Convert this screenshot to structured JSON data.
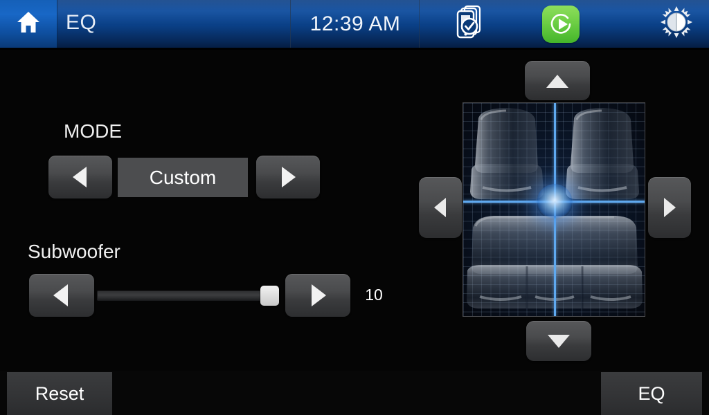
{
  "header": {
    "home_icon": "home-icon",
    "title": "EQ",
    "clock": "12:39 AM",
    "phone_icon": "phone-connected-icon",
    "play_icon": "play-icon",
    "brightness_icon": "brightness-icon"
  },
  "mode": {
    "label": "MODE",
    "prev_icon": "left-arrow-icon",
    "value": "Custom",
    "next_icon": "right-arrow-icon"
  },
  "subwoofer": {
    "label": "Subwoofer",
    "prev_icon": "left-arrow-icon",
    "next_icon": "right-arrow-icon",
    "value": "10",
    "min": 0,
    "max": 10,
    "percent": 100
  },
  "fader": {
    "up_icon": "up-arrow-icon",
    "down_icon": "down-arrow-icon",
    "left_icon": "left-arrow-icon",
    "right_icon": "right-arrow-icon",
    "position_label": "center",
    "balance": 0,
    "fade": 0,
    "accent_color": "#5fa9ef"
  },
  "footer": {
    "reset_label": "Reset",
    "eq_label": "EQ"
  },
  "colors": {
    "header_blue": "#0c4b9d",
    "home_blue": "#1867c6",
    "play_green": "#6ecf45",
    "background": "#050505",
    "button_gray": "#4a4b4d",
    "accent": "#5fa9ef"
  }
}
